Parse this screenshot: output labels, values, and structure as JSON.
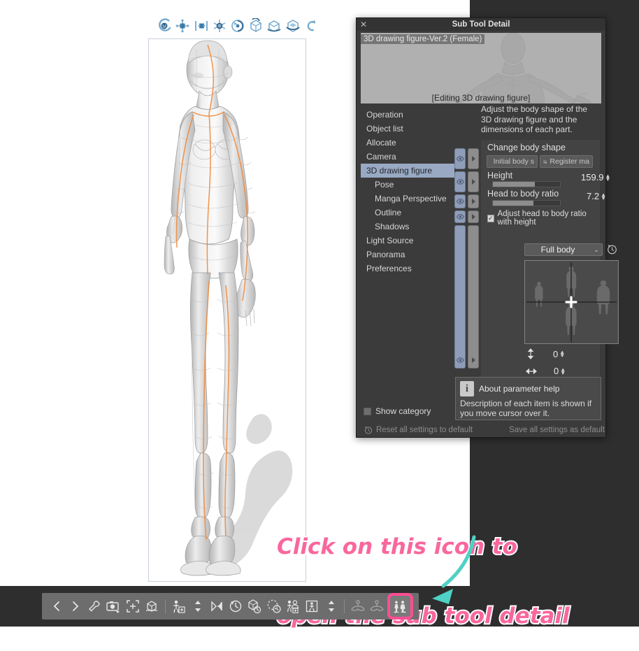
{
  "app": {
    "canvas_bg": "#ffffff",
    "gutter_bg": "#2e2e2e",
    "accent_pink": "#f9679d",
    "highlight_pink": "#ff4d94",
    "arrow_teal": "#4fd1c5"
  },
  "top_toolbar": {
    "name": "3d-object-manipulation-toolbar",
    "icons": [
      {
        "name": "rotate-around-model-icon",
        "glyph": "rotate-model"
      },
      {
        "name": "move-free-icon",
        "glyph": "move-free"
      },
      {
        "name": "move-plane-icon",
        "glyph": "move-plane"
      },
      {
        "name": "move-3d-axis-icon",
        "glyph": "move-axis"
      },
      {
        "name": "rotate-camera-icon",
        "glyph": "rotate-cam"
      },
      {
        "name": "rotate-vertical-icon",
        "glyph": "rot-vert"
      },
      {
        "name": "rotate-horizontal-icon",
        "glyph": "rot-horz"
      },
      {
        "name": "rotate-plane-icon",
        "glyph": "rot-plane"
      },
      {
        "name": "undo-rotation-icon",
        "glyph": "undo"
      }
    ]
  },
  "bottom_toolbar": {
    "name": "3d-figure-bottom-toolbar",
    "icons": [
      {
        "name": "previous-button",
        "glyph": "chev-left",
        "state": "normal"
      },
      {
        "name": "next-button",
        "glyph": "chev-right",
        "state": "normal"
      },
      {
        "name": "tool-settings-button",
        "glyph": "wrench",
        "state": "normal"
      },
      {
        "name": "camera-angle-button",
        "glyph": "camera",
        "state": "normal"
      },
      {
        "name": "fit-to-screen-button",
        "glyph": "fit",
        "state": "normal"
      },
      {
        "name": "reset-camera-button",
        "glyph": "cube-reset",
        "state": "normal"
      },
      {
        "name": "add-figure-button",
        "glyph": "person-add",
        "state": "normal"
      },
      {
        "name": "height-adjust-button",
        "glyph": "up-down",
        "state": "normal"
      },
      {
        "name": "mirror-pose-button",
        "glyph": "mirror",
        "state": "normal"
      },
      {
        "name": "reset-pose-button",
        "glyph": "clock-reset",
        "state": "normal"
      },
      {
        "name": "object-reset-button",
        "glyph": "cube-clock",
        "state": "normal"
      },
      {
        "name": "reset-rotation-button",
        "glyph": "circle-arrow",
        "state": "normal"
      },
      {
        "name": "register-pose-button",
        "glyph": "person-register",
        "state": "normal"
      },
      {
        "name": "pose-scale-button",
        "glyph": "person-frame",
        "state": "normal"
      },
      {
        "name": "pose-updown-button",
        "glyph": "up-down",
        "state": "normal"
      },
      {
        "name": "hand-pose-left-button",
        "glyph": "hand-left",
        "state": "dim"
      },
      {
        "name": "hand-pose-right-button",
        "glyph": "hand-right",
        "state": "dim"
      },
      {
        "name": "sub-tool-detail-button",
        "glyph": "body-shape",
        "state": "highlight"
      }
    ]
  },
  "annotation": {
    "name": "handwritten-callout",
    "line1": "Click on this icon to",
    "line2": "open the sub tool detail",
    "arrow_name": "curved-arrow-to-icon"
  },
  "sub_tool_detail": {
    "title": "Sub Tool Detail",
    "close_label": "✕",
    "preview": {
      "label": "3D drawing figure-Ver.2 (Female)",
      "editing_label": "[Editing 3D drawing figure]"
    },
    "categories": [
      {
        "label": "Operation",
        "sub": false,
        "selected": false
      },
      {
        "label": "Object list",
        "sub": false,
        "selected": false
      },
      {
        "label": "Allocate",
        "sub": false,
        "selected": false
      },
      {
        "label": "Camera",
        "sub": false,
        "selected": false
      },
      {
        "label": "3D drawing figure",
        "sub": false,
        "selected": true
      },
      {
        "label": "Pose",
        "sub": true,
        "selected": false
      },
      {
        "label": "Manga Perspective",
        "sub": true,
        "selected": false
      },
      {
        "label": "Outline",
        "sub": true,
        "selected": false
      },
      {
        "label": "Shadows",
        "sub": true,
        "selected": false
      },
      {
        "label": "Light Source",
        "sub": false,
        "selected": false
      },
      {
        "label": "Panorama",
        "sub": false,
        "selected": false
      },
      {
        "label": "Preferences",
        "sub": false,
        "selected": false
      }
    ],
    "description": "Adjust the body shape of the 3D drawing figure and the dimensions of each part.",
    "change_body_shape": {
      "section_title": "Change body shape",
      "initial_body_button": "Initial body s",
      "register_button": "Register ma"
    },
    "height": {
      "label": "Height",
      "value": "159.9",
      "slider_percent": 62
    },
    "head_to_body_ratio": {
      "label": "Head to body ratio",
      "value": "7.2",
      "slider_percent": 60
    },
    "adjust_checkbox": {
      "label": "Adjust head to body ratio with height",
      "checked": true,
      "mark": "✓"
    },
    "body_part_select": {
      "value": "Full body",
      "chevron": "⌄",
      "reset_icon_name": "reset-clock-icon"
    },
    "body_shape_pad": {
      "vertical_label_icon": "vertical-arrow-icon",
      "vertical_value": "0",
      "horizontal_label_icon": "horizontal-arrow-icon",
      "horizontal_value": "0"
    },
    "info": {
      "title": "About parameter help",
      "description": "Description of each item is shown if you move cursor over it.",
      "icon_letter": "i"
    },
    "show_category": {
      "label": "Show category",
      "checked": false
    },
    "footer": {
      "reset_label": "Reset all settings to default",
      "save_label": "Save all settings as default"
    }
  }
}
